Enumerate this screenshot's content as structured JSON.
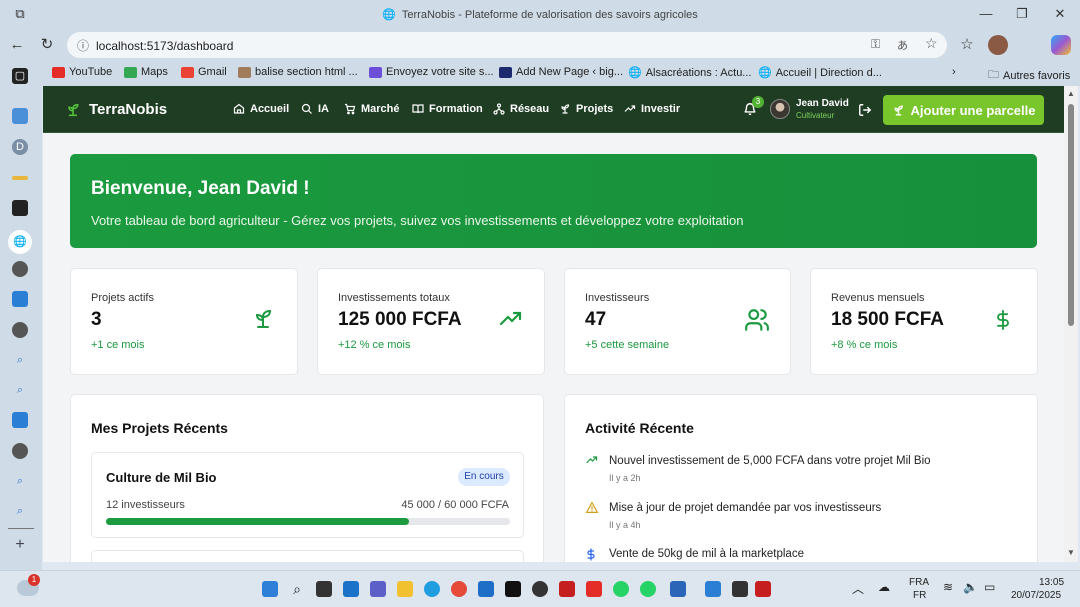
{
  "browser": {
    "tab_title": "TerraNobis - Plateforme de valorisation des savoirs agricoles",
    "url": "localhost:5173/dashboard",
    "bookmarks": [
      "YouTube",
      "Maps",
      "Gmail",
      "balise section html ...",
      "Envoyez votre site s...",
      "Add New Page ‹ big...",
      "Alsacréations : Actu...",
      "Accueil | Direction d..."
    ],
    "other_favorites": "Autres favoris"
  },
  "app": {
    "brand": "TerraNobis",
    "nav": [
      "Accueil",
      "IA",
      "Marché",
      "Formation",
      "Réseau",
      "Projets",
      "Investir"
    ],
    "notifications_count": "3",
    "user_name": "Jean David",
    "user_role": "Cultivateur",
    "add_parcel_label": "Ajouter une parcelle",
    "accent_color": "#1b9a3f",
    "header_color": "#1e3d23"
  },
  "hero": {
    "title": "Bienvenue, Jean David !",
    "subtitle": "Votre tableau de bord agriculteur - Gérez vos projets, suivez vos investissements et développez votre exploitation"
  },
  "stats": [
    {
      "label": "Projets actifs",
      "value": "3",
      "delta": "+1 ce mois",
      "icon": "sprout-icon"
    },
    {
      "label": "Investissements totaux",
      "value": "125 000 FCFA",
      "delta": "+12 % ce mois",
      "icon": "trending-up-icon"
    },
    {
      "label": "Investisseurs",
      "value": "47",
      "delta": "+5 cette semaine",
      "icon": "users-icon"
    },
    {
      "label": "Revenus mensuels",
      "value": "18 500 FCFA",
      "delta": "+8 % ce mois",
      "icon": "dollar-icon"
    }
  ],
  "projects": {
    "title": "Mes Projets Récents",
    "items": [
      {
        "name": "Culture de Mil Bio",
        "status": "En cours",
        "investors": "12 investisseurs",
        "amount": "45 000 / 60 000 FCFA",
        "progress": 0.75
      }
    ]
  },
  "activity": {
    "title": "Activité Récente",
    "items": [
      {
        "text": "Nouvel investissement de 5,000 FCFA dans votre projet Mil Bio",
        "time": "Il y a 2h",
        "icon": "trending-up-icon"
      },
      {
        "text": "Mise à jour de projet demandée par vos investisseurs",
        "time": "Il y a 4h",
        "icon": "warning-icon"
      },
      {
        "text": "Vente de 50kg de mil à la marketplace",
        "time": "",
        "icon": "dollar-icon"
      }
    ]
  },
  "taskbar": {
    "weather_badge": "1",
    "lang1": "FRA",
    "lang2": "FR",
    "time": "13:05",
    "date": "20/07/2025"
  }
}
